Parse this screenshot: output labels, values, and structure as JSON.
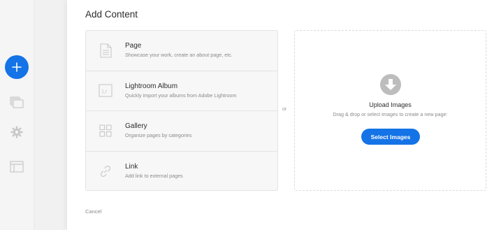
{
  "rail": {
    "add_icon": "plus-icon",
    "items": [
      {
        "icon": "pages-icon"
      },
      {
        "icon": "gear-icon"
      },
      {
        "icon": "layout-icon"
      }
    ]
  },
  "dialog": {
    "title": "Add Content",
    "options": [
      {
        "title": "Page",
        "description": "Showcase your work, create an about page, etc.",
        "icon": "page-icon"
      },
      {
        "title": "Lightroom Album",
        "description": "Quickly import your albums from Adobe Lightroom",
        "icon": "lightroom-icon",
        "icon_text": "Lr"
      },
      {
        "title": "Gallery",
        "description": "Organize pages by categories",
        "icon": "grid-icon"
      },
      {
        "title": "Link",
        "description": "Add link to external pages",
        "icon": "link-icon"
      }
    ],
    "or_label": "or",
    "upload": {
      "title": "Upload Images",
      "subtitle": "Drag & drop or select images to create a new page:",
      "button_label": "Select Images",
      "icon": "download-arrow-icon"
    },
    "cancel_label": "Cancel"
  },
  "colors": {
    "accent": "#1473e6",
    "icon_gray": "#c8c8c8"
  }
}
